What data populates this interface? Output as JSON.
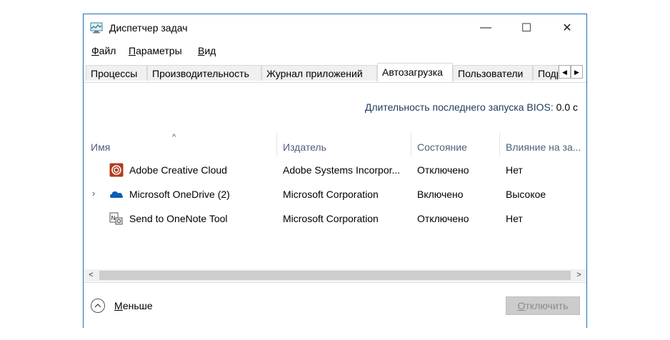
{
  "window": {
    "title": "Диспетчер задач",
    "controls": {
      "minimize": "—",
      "maximize": "☐",
      "close": "✕"
    }
  },
  "menu": {
    "file": {
      "ul": "Ф",
      "rest": "айл"
    },
    "params": {
      "ul": "П",
      "rest": "араметры"
    },
    "view": {
      "ul": "В",
      "rest": "ид"
    }
  },
  "tabs": [
    {
      "label": "Процессы",
      "active": false
    },
    {
      "label": "Производительность",
      "active": false
    },
    {
      "label": "Журнал приложений",
      "active": false
    },
    {
      "label": "Автозагрузка",
      "active": true
    },
    {
      "label": "Пользователи",
      "active": false
    },
    {
      "label": "Подробности",
      "active": false
    }
  ],
  "bios": {
    "label": "Длительность последнего запуска BIOS:",
    "value": "0.0 с"
  },
  "columns": {
    "name": "Имя",
    "publisher": "Издатель",
    "status": "Состояние",
    "impact": "Влияние на за..."
  },
  "rows": [
    {
      "expandable": false,
      "icon": "creative-cloud-icon",
      "name": "Adobe Creative Cloud",
      "publisher": "Adobe Systems Incorpor...",
      "status": "Отключено",
      "impact": "Нет"
    },
    {
      "expandable": true,
      "expander": "›",
      "icon": "onedrive-icon",
      "name": "Microsoft OneDrive (2)",
      "publisher": "Microsoft Corporation",
      "status": "Включено",
      "impact": "Высокое"
    },
    {
      "expandable": false,
      "icon": "onenote-icon",
      "name": "Send to OneNote Tool",
      "publisher": "Microsoft Corporation",
      "status": "Отключено",
      "impact": "Нет"
    }
  ],
  "footer": {
    "less": {
      "ul": "М",
      "rest": "еньше"
    },
    "disable": {
      "ul": "О",
      "rest": "тключить"
    }
  },
  "colors": {
    "accent_border": "#1f6fb4",
    "header_text": "#4c607a",
    "bios_text": "#1e395b"
  }
}
